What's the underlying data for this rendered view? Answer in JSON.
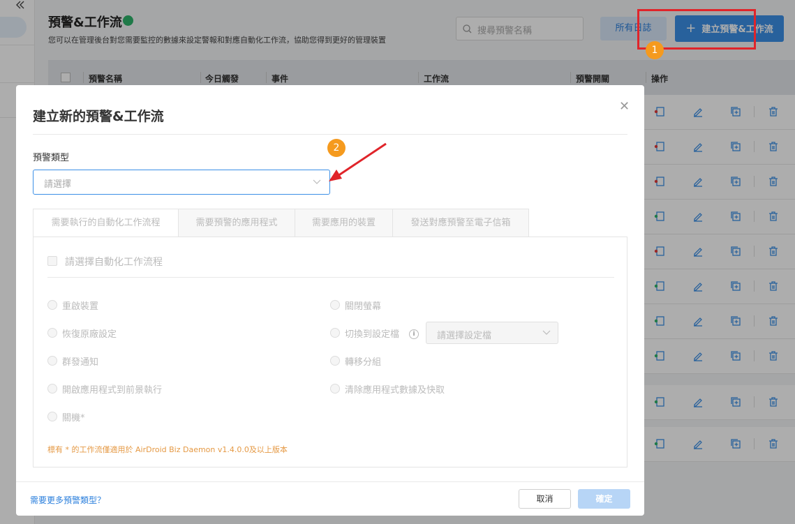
{
  "page": {
    "title": "預警&工作流",
    "description": "您可以在管理後台對您需要監控的數據來設定警報和對應自動化工作流，協助您得到更好的管理裝置",
    "search_placeholder": "搜尋預警名稱",
    "all_logs_label": "所有日誌",
    "create_label": "建立預警&工作流",
    "create_icon": "plus-icon"
  },
  "table": {
    "columns": [
      "預警名稱",
      "今日觸發",
      "事件",
      "工作流",
      "預警開關",
      "操作"
    ],
    "row_count": 10,
    "row_icons": [
      "move-icon",
      "edit-icon",
      "copy-icon",
      "delete-icon"
    ]
  },
  "annotations": {
    "step1": "1",
    "step2": "2",
    "highlight_color": "#e0242a",
    "badge_color": "#f59a1e"
  },
  "modal": {
    "title": "建立新的預警&工作流",
    "alert_type_label": "預警類型",
    "alert_type_placeholder": "請選擇",
    "tabs": [
      "需要執行的自動化工作流程",
      "需要預警的應用程式",
      "需要應用的裝置",
      "發送對應預警至電子信箱"
    ],
    "select_workflow_label": "請選擇自動化工作流程",
    "options_left": [
      "重啟裝置",
      "恢復原廠設定",
      "群發通知",
      "開啟應用程式到前景執行",
      "關機*"
    ],
    "options_right": [
      "關閉螢幕",
      "切換到設定檔",
      "轉移分組",
      "清除應用程式數據及快取"
    ],
    "profile_placeholder": "請選擇設定檔",
    "note": "標有 * 的工作流僅適用於 AirDroid Biz Daemon v1.4.0.0及以上版本",
    "more_types_link": "需要更多預警類型？",
    "cancel_label": "取消",
    "confirm_label": "確定"
  },
  "colors": {
    "accent": "#3b8fe6",
    "link": "#2b7fdc",
    "note": "#e59944"
  }
}
